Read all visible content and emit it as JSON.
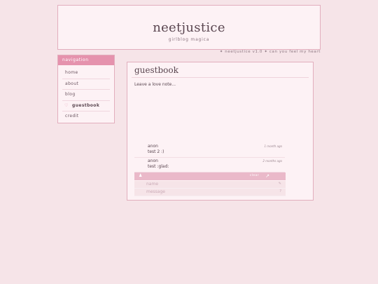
{
  "header": {
    "title": "neetjustice",
    "subtitle": "girlblog magica"
  },
  "ticker": "✦ neetjustice v1.0 ✦ can you feel my heart",
  "nav": {
    "heading": "navigation",
    "items": [
      {
        "label": "home",
        "active": false
      },
      {
        "label": "about",
        "active": false
      },
      {
        "label": "blog",
        "active": false
      },
      {
        "label": "guestbook",
        "active": true
      },
      {
        "label": "credit",
        "active": false
      }
    ],
    "active_marker": "♡"
  },
  "main": {
    "title": "guestbook",
    "intro": "Leave a love note..."
  },
  "guestbook": {
    "entries": [
      {
        "name": "anon",
        "message": "test 2 :)",
        "time": "1 month ago"
      },
      {
        "name": "anon",
        "message": "test :glad:",
        "time": "2 months ago"
      }
    ],
    "form": {
      "clear_label": "clear",
      "name_placeholder": "name",
      "message_placeholder": "message"
    }
  },
  "colors": {
    "page_bg": "#f6e4e8",
    "panel_bg": "#fdf2f5",
    "border": "#e2aebd",
    "accent": "#e592ad",
    "form_bar": "#eab9c9"
  }
}
